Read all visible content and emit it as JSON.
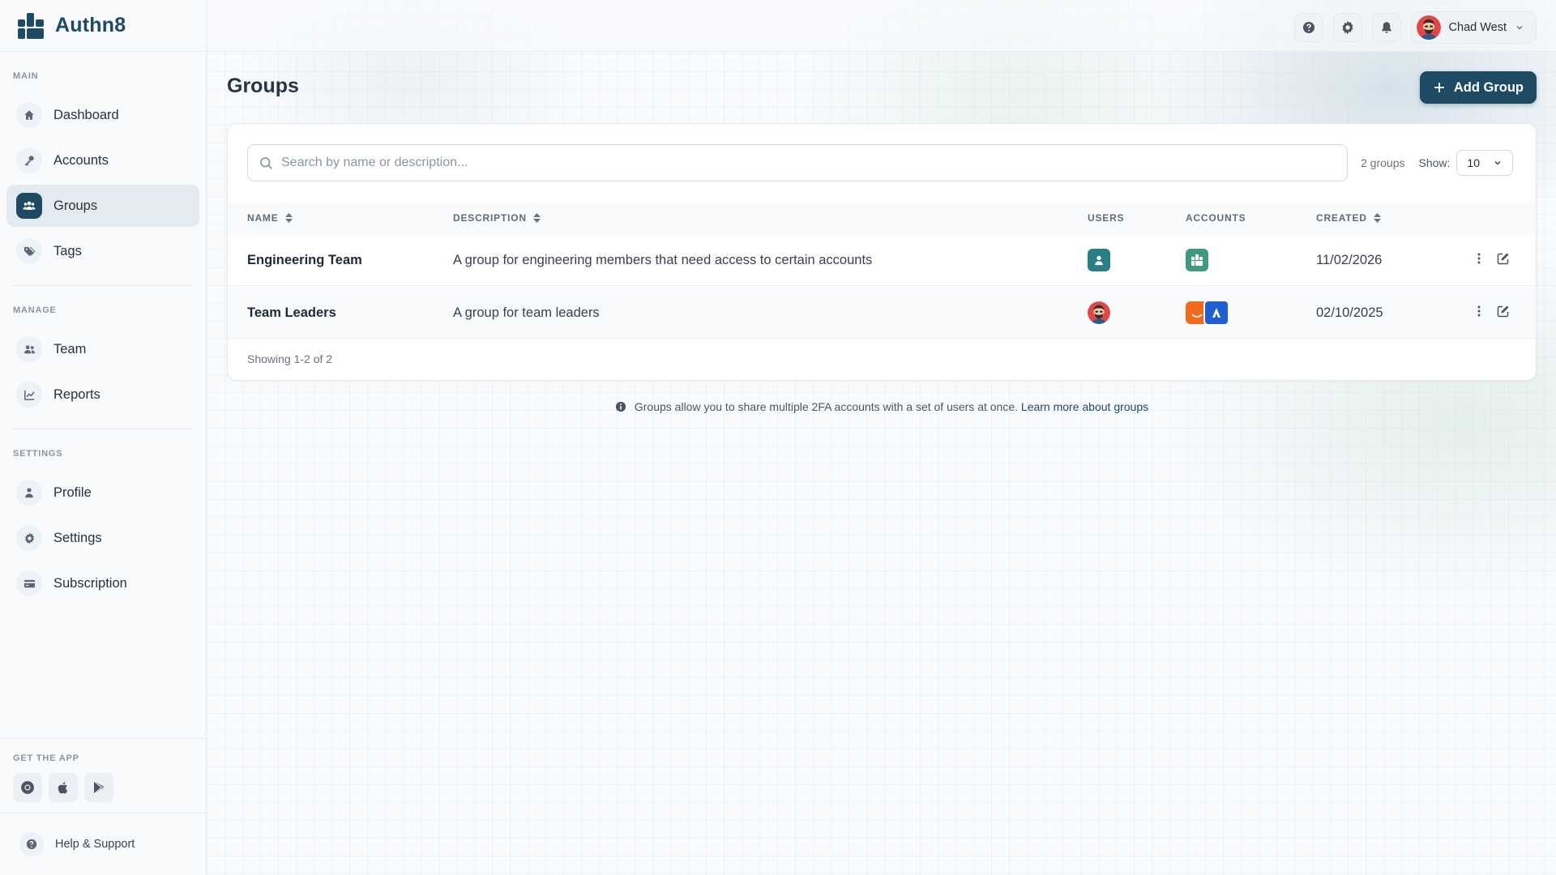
{
  "brand": {
    "name": "Authn8",
    "color": "#1e4a64"
  },
  "sidebar": {
    "sections": {
      "main": "MAIN",
      "manage": "MANAGE",
      "settings": "SETTINGS",
      "get_app": "GET THE APP"
    },
    "main_items": [
      {
        "label": "Dashboard",
        "icon": "home-icon"
      },
      {
        "label": "Accounts",
        "icon": "key-icon"
      },
      {
        "label": "Groups",
        "icon": "users-group-icon",
        "active": true
      },
      {
        "label": "Tags",
        "icon": "tags-icon"
      }
    ],
    "manage_items": [
      {
        "label": "Team",
        "icon": "team-icon"
      },
      {
        "label": "Reports",
        "icon": "chart-line-icon"
      }
    ],
    "settings_items": [
      {
        "label": "Profile",
        "icon": "user-icon"
      },
      {
        "label": "Settings",
        "icon": "gear-icon"
      },
      {
        "label": "Subscription",
        "icon": "credit-card-icon"
      }
    ],
    "apps": [
      "chrome-icon",
      "apple-icon",
      "google-play-icon"
    ],
    "help_label": "Help & Support"
  },
  "topbar": {
    "user_name": "Chad West",
    "icons": [
      "help-icon",
      "gear-icon",
      "bell-icon",
      "chevron-down-icon"
    ]
  },
  "page": {
    "title": "Groups",
    "add_button": "Add Group"
  },
  "search": {
    "placeholder": "Search by name or description...",
    "value": ""
  },
  "count_label": "2 groups",
  "show_label": "Show:",
  "show_value": "10",
  "table": {
    "columns": [
      "NAME",
      "DESCRIPTION",
      "USERS",
      "ACCOUNTS",
      "CREATED"
    ],
    "rows": [
      {
        "name": "Engineering Team",
        "description": "A group for engineering members that need access to certain accounts",
        "created": "11/02/2026"
      },
      {
        "name": "Team Leaders",
        "description": "A group for team leaders",
        "created": "02/10/2025"
      }
    ]
  },
  "showing_label": "Showing 1-2 of 2",
  "info": {
    "text": "Groups allow you to share multiple 2FA accounts with a set of users at once.",
    "link": "Learn more about groups"
  }
}
